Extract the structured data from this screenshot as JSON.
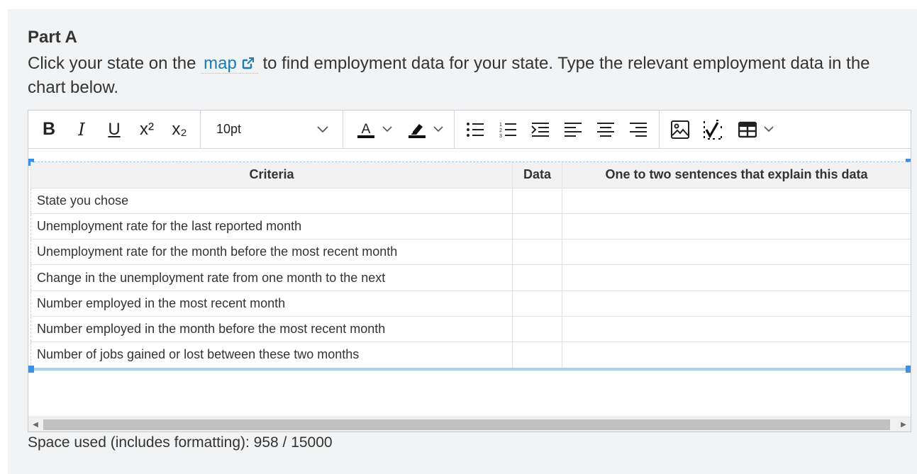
{
  "part": {
    "title": "Part A"
  },
  "prompt": {
    "before": "Click your state on the",
    "link_text": "map",
    "after": "to find employment data for your state. Type the relevant employment data in the chart below."
  },
  "toolbar": {
    "bold": "B",
    "italic": "I",
    "underline": "U",
    "superscript_label": "x²",
    "subscript_label": "x₂",
    "font_size": "10pt",
    "icons": [
      "bold-icon",
      "italic-icon",
      "underline-icon",
      "superscript-icon",
      "subscript-icon",
      "chevron-down-icon",
      "text-color-icon",
      "highlight-icon",
      "bullet-list-icon",
      "numbered-list-icon",
      "outdent-icon",
      "align-left-icon",
      "align-center-icon",
      "align-right-icon",
      "image-icon",
      "math-icon",
      "table-icon"
    ]
  },
  "table": {
    "headers": [
      "Criteria",
      "Data",
      "One to two sentences that explain this data"
    ],
    "rows": [
      [
        "State you chose",
        "",
        ""
      ],
      [
        "Unemployment rate for the last reported month",
        "",
        ""
      ],
      [
        "Unemployment rate for the month before the most recent month",
        "",
        ""
      ],
      [
        "Change in the unemployment rate from one month to the next",
        "",
        ""
      ],
      [
        "Number employed in the most recent month",
        "",
        ""
      ],
      [
        "Number employed in the month before the most recent month",
        "",
        ""
      ],
      [
        "Number of jobs gained or lost between these two months",
        "",
        ""
      ]
    ]
  },
  "footer": {
    "space_used": "Space used (includes formatting): 958 / 15000"
  },
  "colors": {
    "link": "#1a7bb4",
    "panel_bg": "#f2f3f4",
    "selection": "#3b8fe4"
  }
}
